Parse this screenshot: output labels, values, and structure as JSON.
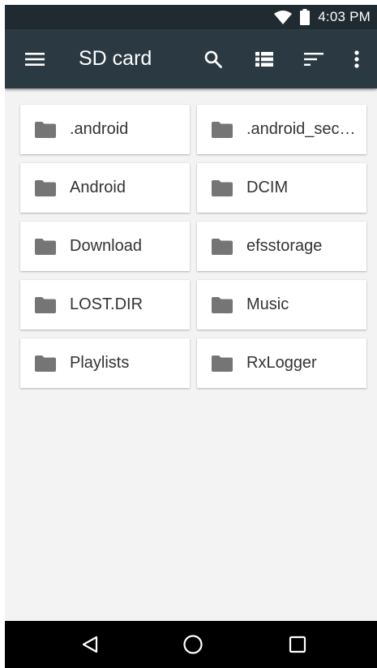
{
  "status_bar": {
    "time": "4:03 PM",
    "icons": [
      "wifi-icon",
      "battery-icon"
    ]
  },
  "toolbar": {
    "title": "SD card",
    "icons": [
      "menu-icon",
      "search-icon",
      "list-view-icon",
      "sort-icon",
      "more-vert-icon"
    ]
  },
  "folders": [
    {
      "name": ".android"
    },
    {
      "name": ".android_sec…"
    },
    {
      "name": "Android"
    },
    {
      "name": "DCIM"
    },
    {
      "name": "Download"
    },
    {
      "name": "efsstorage"
    },
    {
      "name": "LOST.DIR"
    },
    {
      "name": "Music"
    },
    {
      "name": "Playlists"
    },
    {
      "name": "RxLogger"
    }
  ],
  "nav_bar": {
    "icons": [
      "back-icon",
      "home-icon",
      "recents-icon"
    ]
  },
  "colors": {
    "status_bar_bg": "#1f2b31",
    "toolbar_bg": "#2b3a42",
    "content_bg": "#f3f3f3",
    "tile_bg": "#ffffff",
    "folder_icon": "#757575",
    "text": "#333333"
  }
}
